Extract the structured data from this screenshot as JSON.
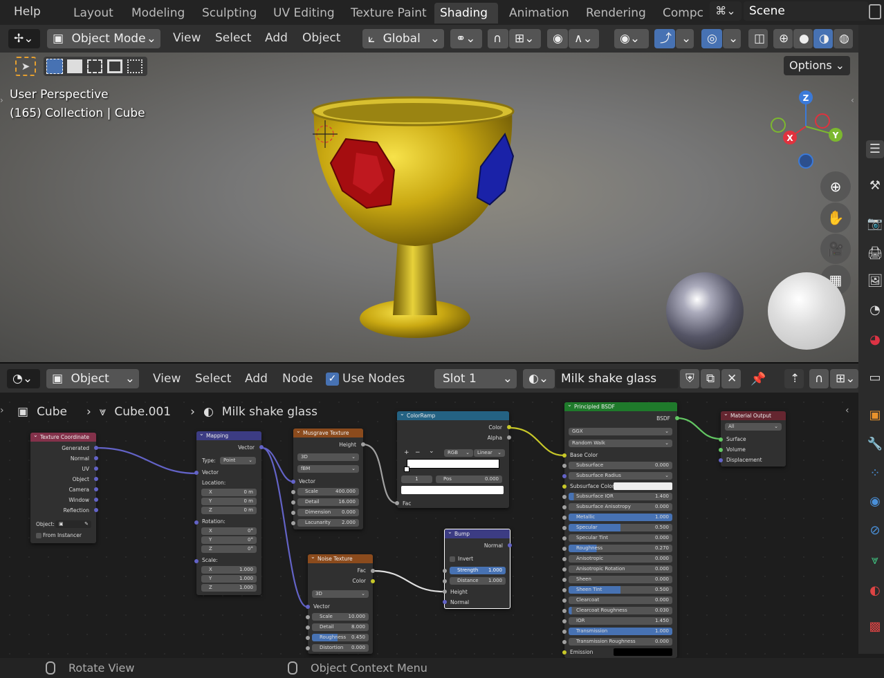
{
  "topbar": {
    "help": "Help",
    "tabs": [
      "Layout",
      "Modeling",
      "Sculpting",
      "UV Editing",
      "Texture Paint",
      "Shading",
      "Animation",
      "Rendering",
      "Compc"
    ],
    "active_tab": "Shading",
    "scene": "Scene"
  },
  "vp_header": {
    "mode": "Object Mode",
    "menus": [
      "View",
      "Select",
      "Add",
      "Object"
    ],
    "transform": "Global",
    "options": "Options"
  },
  "viewport": {
    "perspective": "User Perspective",
    "collection": "(165) Collection | Cube",
    "axes": {
      "x": "X",
      "y": "Y",
      "z": "Z"
    }
  },
  "ne_header": {
    "type": "Object",
    "menus": [
      "View",
      "Select",
      "Add",
      "Node"
    ],
    "use_nodes": "Use Nodes",
    "slot": "Slot 1",
    "material": "Milk shake glass"
  },
  "breadcrumb": {
    "object": "Cube",
    "mesh": "Cube.001",
    "material": "Milk shake glass"
  },
  "status": {
    "left": "Rotate View",
    "right": "Object Context Menu"
  },
  "nodes": {
    "texcoord": {
      "title": "Texture Coordinate",
      "outputs": [
        "Generated",
        "Normal",
        "UV",
        "Object",
        "Camera",
        "Window",
        "Reflection"
      ],
      "object_label": "Object:",
      "from_instancer": "From Instancer"
    },
    "mapping": {
      "title": "Mapping",
      "out": "Vector",
      "type_label": "Type:",
      "type": "Point",
      "in_vector": "Vector",
      "location": "Location:",
      "loc": [
        [
          "X",
          "0 m"
        ],
        [
          "Y",
          "0 m"
        ],
        [
          "Z",
          "0 m"
        ]
      ],
      "rotation": "Rotation:",
      "rot": [
        [
          "X",
          "0°"
        ],
        [
          "Y",
          "0°"
        ],
        [
          "Z",
          "0°"
        ]
      ],
      "scale": "Scale:",
      "scl": [
        [
          "X",
          "1.000"
        ],
        [
          "Y",
          "1.000"
        ],
        [
          "Z",
          "1.000"
        ]
      ]
    },
    "musgrave": {
      "title": "Musgrave Texture",
      "out": "Height",
      "dim": "3D",
      "mtype": "fBM",
      "in_vector": "Vector",
      "fields": [
        [
          "Scale",
          "400.000"
        ],
        [
          "Detail",
          "16.000"
        ],
        [
          "Dimension",
          "0.000"
        ],
        [
          "Lacunarity",
          "2.000"
        ]
      ]
    },
    "colorramp": {
      "title": "ColorRamp",
      "outputs": [
        "Color",
        "Alpha"
      ],
      "mode": "RGB",
      "interp": "Linear",
      "index": "1",
      "pos_label": "Pos",
      "pos": "0.000",
      "fac": "Fac",
      "plus": "+",
      "minus": "−",
      "chevron": "⌄"
    },
    "noise": {
      "title": "Noise Texture",
      "outputs": [
        "Fac",
        "Color"
      ],
      "dim": "3D",
      "in_vector": "Vector",
      "fields": [
        [
          "Scale",
          "10.000"
        ],
        [
          "Detail",
          "8.000"
        ],
        [
          "Roughness",
          "0.450"
        ],
        [
          "Distortion",
          "0.000"
        ]
      ]
    },
    "bump": {
      "title": "Bump",
      "out": "Normal",
      "invert": "Invert",
      "fields": [
        [
          "Strength",
          "1.000"
        ],
        [
          "Distance",
          "1.000"
        ]
      ],
      "inputs": [
        "Height",
        "Normal"
      ]
    },
    "bsdf": {
      "title": "Principled BSDF",
      "out": "BSDF",
      "dist": "GGX",
      "sss": "Random Walk",
      "base_color": "Base Color",
      "subsurface_radius": "Subsurface Radius",
      "subsurface_color": "Subsurface Color",
      "emission": "Emission",
      "fields": [
        [
          "Subsurface",
          "0.000",
          0
        ],
        [
          "Subsurface IOR",
          "1.400",
          0.05
        ],
        [
          "Subsurface Anisotropy",
          "0.000",
          0
        ],
        [
          "Metallic",
          "1.000",
          1
        ],
        [
          "Specular",
          "0.500",
          0.5
        ],
        [
          "Specular Tint",
          "0.000",
          0
        ],
        [
          "Roughness",
          "0.270",
          0.27
        ],
        [
          "Anisotropic",
          "0.000",
          0
        ],
        [
          "Anisotropic Rotation",
          "0.000",
          0
        ],
        [
          "Sheen",
          "0.000",
          0
        ],
        [
          "Sheen Tint",
          "0.500",
          0.5
        ],
        [
          "Clearcoat",
          "0.000",
          0
        ],
        [
          "Clearcoat Roughness",
          "0.030",
          0.03
        ],
        [
          "IOR",
          "1.450",
          0
        ],
        [
          "Transmission",
          "1.000",
          1
        ],
        [
          "Transmission Roughness",
          "0.000",
          0
        ]
      ]
    },
    "output": {
      "title": "Material Output",
      "target": "All",
      "inputs": [
        "Surface",
        "Volume",
        "Displacement"
      ]
    }
  },
  "colors": {
    "accent": "#4772b3",
    "texture_hdr": "#8b4b1d",
    "vector_hdr": "#3c3c83",
    "input_hdr": "#83314a",
    "converter_hdr": "#246283",
    "shader_hdr": "#1f7a2b",
    "output_hdr": "#652630"
  }
}
